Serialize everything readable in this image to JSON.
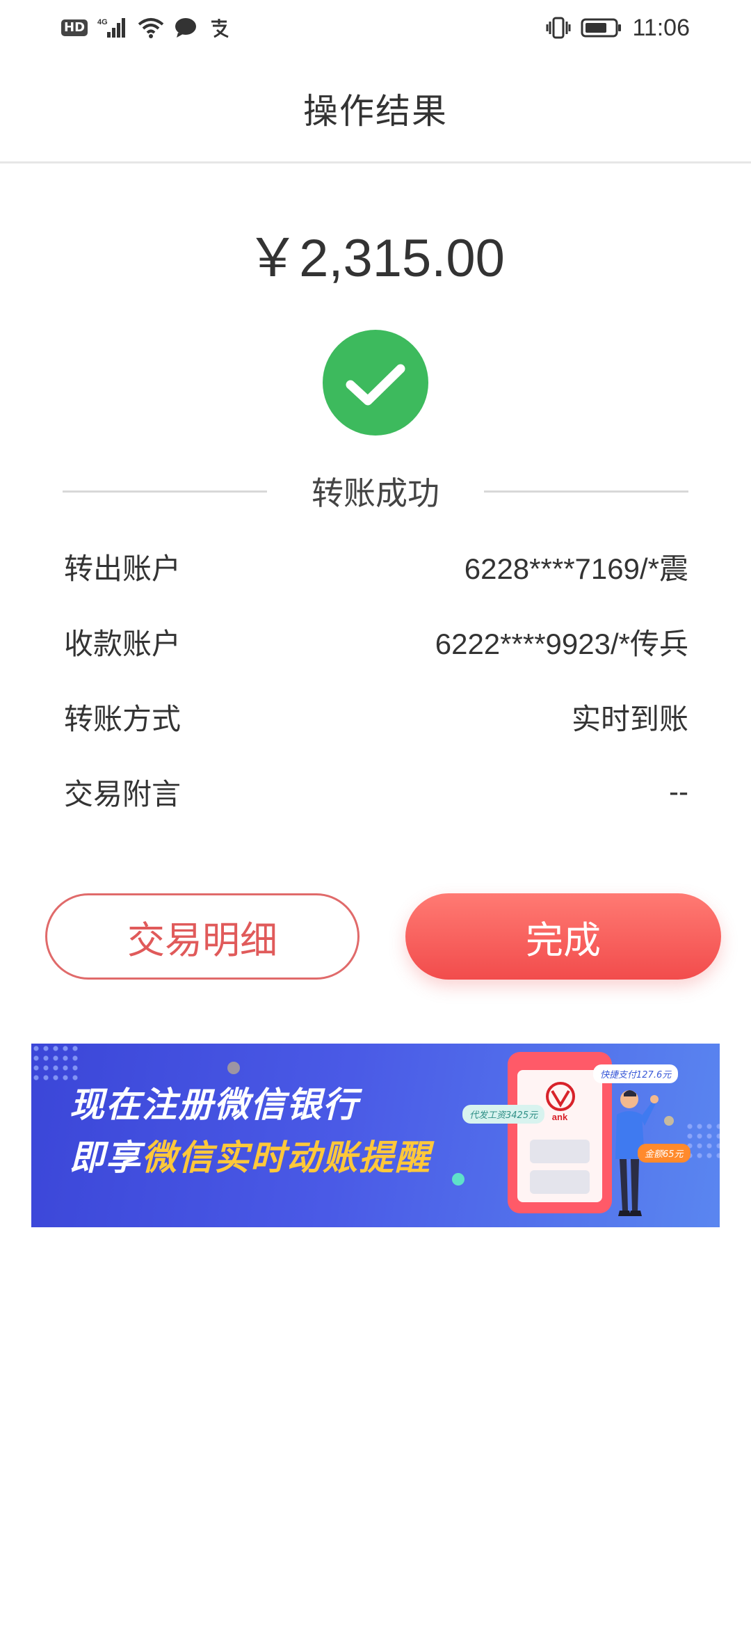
{
  "status_bar": {
    "hd_label": "HD",
    "network_label": "4G",
    "time": "11:06",
    "icons": [
      "hd-icon",
      "signal-icon",
      "wifi-icon",
      "message-icon",
      "alipay-icon",
      "vibrate-icon",
      "battery-icon"
    ]
  },
  "header": {
    "title": "操作结果"
  },
  "result": {
    "amount": "￥2,315.00",
    "status_icon": "check-circle-icon",
    "status_text": "转账成功",
    "colors": {
      "success": "#3dba5d"
    }
  },
  "details": [
    {
      "label": "转出账户",
      "value": "6228****7169/*震"
    },
    {
      "label": "收款账户",
      "value": "6222****9923/*传兵"
    },
    {
      "label": "转账方式",
      "value": "实时到账"
    },
    {
      "label": "交易附言",
      "value": "--"
    }
  ],
  "actions": {
    "detail_label": "交易明细",
    "done_label": "完成",
    "colors": {
      "accent": "#f25555"
    }
  },
  "banner": {
    "line1": "现在注册微信银行",
    "line2_prefix": "即享",
    "line2_highlight": "微信实时动账提醒",
    "tag_salary": "代发工资3425元",
    "tag_pay": "快捷支付127.6元",
    "tag_amount": "金额65元",
    "bank_text": "ank"
  }
}
